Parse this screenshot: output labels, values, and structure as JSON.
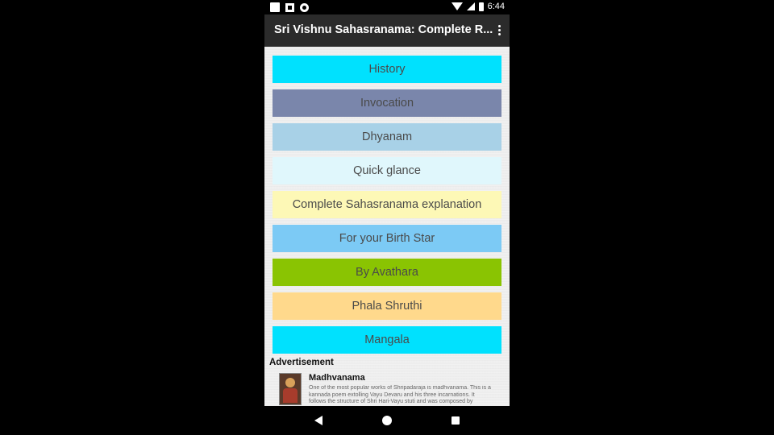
{
  "status_bar": {
    "time": "6:44"
  },
  "app_bar": {
    "title": "Sri Vishnu Sahasranama: Complete R..."
  },
  "menu": [
    {
      "label": "History",
      "color": "#00e1fe"
    },
    {
      "label": "Invocation",
      "color": "#7a86ab"
    },
    {
      "label": "Dhyanam",
      "color": "#a8d1e7"
    },
    {
      "label": "Quick glance",
      "color": "#e0f7fc"
    },
    {
      "label": "Complete Sahasranama explanation",
      "color": "#fdf8b6"
    },
    {
      "label": "For your Birth Star",
      "color": "#7ccaf5"
    },
    {
      "label": "By Avathara",
      "color": "#8ac402"
    },
    {
      "label": "Phala Shruthi",
      "color": "#ffd98c"
    },
    {
      "label": "Mangala",
      "color": "#00e1fe"
    }
  ],
  "ad": {
    "label": "Advertisement",
    "title": "Madhvanama",
    "description": "One of the most popular works of Shripadaraja is madhvanama. This is a kannada poem extolling Vayu Devaru and his three incarnations. It follows the structure of Shri Hari-Vayu stuti and was composed by"
  },
  "icons": {
    "status_left": [
      "notification-square-icon",
      "sim-icon",
      "record-icon"
    ],
    "status_right": [
      "wifi-icon",
      "signal-icon",
      "battery-icon"
    ],
    "app_bar": "overflow-menu-icon",
    "nav": [
      "back-icon",
      "home-icon",
      "recents-icon"
    ]
  }
}
